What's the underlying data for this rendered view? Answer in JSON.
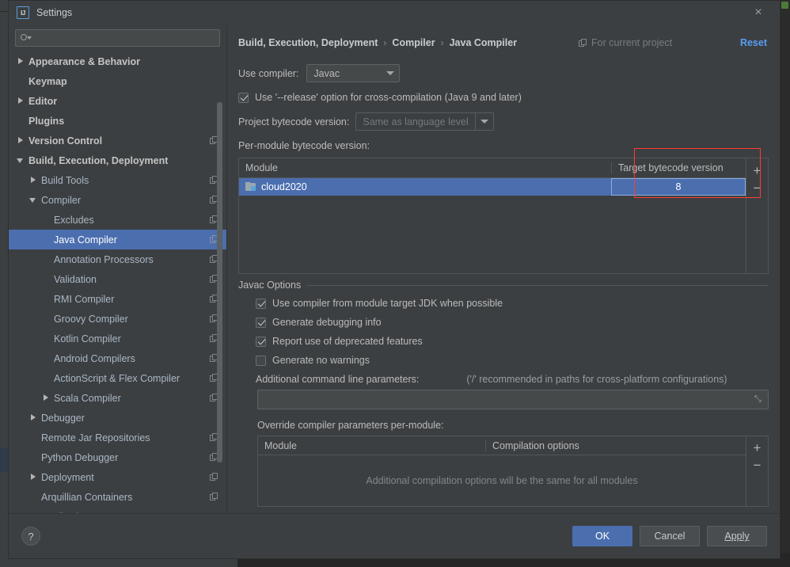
{
  "window": {
    "title": "Settings",
    "app_icon": "IJ",
    "close_icon": "×"
  },
  "sidebar": {
    "search": {
      "placeholder": "",
      "value": ""
    },
    "items": [
      {
        "label": "Appearance & Behavior",
        "indent": 0,
        "arrow": "right",
        "bold": true,
        "copy": false,
        "selected": false
      },
      {
        "label": "Keymap",
        "indent": 0,
        "arrow": "none",
        "bold": true,
        "copy": false,
        "selected": false
      },
      {
        "label": "Editor",
        "indent": 0,
        "arrow": "right",
        "bold": true,
        "copy": false,
        "selected": false
      },
      {
        "label": "Plugins",
        "indent": 0,
        "arrow": "none",
        "bold": true,
        "copy": false,
        "selected": false
      },
      {
        "label": "Version Control",
        "indent": 0,
        "arrow": "right",
        "bold": true,
        "copy": true,
        "selected": false
      },
      {
        "label": "Build, Execution, Deployment",
        "indent": 0,
        "arrow": "down",
        "bold": true,
        "copy": false,
        "selected": false
      },
      {
        "label": "Build Tools",
        "indent": 1,
        "arrow": "right",
        "bold": false,
        "copy": true,
        "selected": false
      },
      {
        "label": "Compiler",
        "indent": 1,
        "arrow": "down",
        "bold": false,
        "copy": true,
        "selected": false
      },
      {
        "label": "Excludes",
        "indent": 2,
        "arrow": "none",
        "bold": false,
        "copy": true,
        "selected": false
      },
      {
        "label": "Java Compiler",
        "indent": 2,
        "arrow": "none",
        "bold": false,
        "copy": true,
        "selected": true
      },
      {
        "label": "Annotation Processors",
        "indent": 2,
        "arrow": "none",
        "bold": false,
        "copy": true,
        "selected": false
      },
      {
        "label": "Validation",
        "indent": 2,
        "arrow": "none",
        "bold": false,
        "copy": true,
        "selected": false
      },
      {
        "label": "RMI Compiler",
        "indent": 2,
        "arrow": "none",
        "bold": false,
        "copy": true,
        "selected": false
      },
      {
        "label": "Groovy Compiler",
        "indent": 2,
        "arrow": "none",
        "bold": false,
        "copy": true,
        "selected": false
      },
      {
        "label": "Kotlin Compiler",
        "indent": 2,
        "arrow": "none",
        "bold": false,
        "copy": true,
        "selected": false
      },
      {
        "label": "Android Compilers",
        "indent": 2,
        "arrow": "none",
        "bold": false,
        "copy": true,
        "selected": false
      },
      {
        "label": "ActionScript & Flex Compiler",
        "indent": 2,
        "arrow": "none",
        "bold": false,
        "copy": true,
        "selected": false
      },
      {
        "label": "Scala Compiler",
        "indent": 2,
        "arrow": "right",
        "bold": false,
        "copy": true,
        "selected": false
      },
      {
        "label": "Debugger",
        "indent": 1,
        "arrow": "right",
        "bold": false,
        "copy": false,
        "selected": false
      },
      {
        "label": "Remote Jar Repositories",
        "indent": 1,
        "arrow": "none",
        "bold": false,
        "copy": true,
        "selected": false
      },
      {
        "label": "Python Debugger",
        "indent": 1,
        "arrow": "none",
        "bold": false,
        "copy": true,
        "selected": false
      },
      {
        "label": "Deployment",
        "indent": 1,
        "arrow": "right",
        "bold": false,
        "copy": true,
        "selected": false
      },
      {
        "label": "Arquillian Containers",
        "indent": 1,
        "arrow": "none",
        "bold": false,
        "copy": true,
        "selected": false
      },
      {
        "label": "Application Servers",
        "indent": 1,
        "arrow": "none",
        "bold": false,
        "copy": false,
        "selected": false
      }
    ]
  },
  "main": {
    "breadcrumb": [
      "Build, Execution, Deployment",
      "Compiler",
      "Java Compiler"
    ],
    "breadcrumb_separator": "›",
    "for_current_project": "For current project",
    "reset_label": "Reset",
    "use_compiler_label": "Use compiler:",
    "use_compiler_value": "Javac",
    "release_option_label": "Use '--release' option for cross-compilation (Java 9 and later)",
    "release_option_checked": true,
    "project_bytecode_label": "Project bytecode version:",
    "project_bytecode_value": "Same as language level",
    "per_module_label": "Per-module bytecode version:",
    "module_table": {
      "columns": [
        "Module",
        "Target bytecode version"
      ],
      "rows": [
        {
          "module": "cloud2020",
          "target": "8",
          "selected": true
        }
      ],
      "add_label": "+",
      "remove_label": "−"
    },
    "javac_options": {
      "title": "Javac Options",
      "checkboxes": [
        {
          "label": "Use compiler from module target JDK when possible",
          "checked": true
        },
        {
          "label": "Generate debugging info",
          "checked": true
        },
        {
          "label": "Report use of deprecated features",
          "checked": true
        },
        {
          "label": "Generate no warnings",
          "checked": false
        }
      ],
      "params_label": "Additional command line parameters:",
      "params_hint": "('/' recommended in paths for cross-platform configurations)",
      "params_value": "",
      "expand_icon": "⤡",
      "override_label": "Override compiler parameters per-module:",
      "override_table": {
        "columns": [
          "Module",
          "Compilation options"
        ],
        "empty_text": "Additional compilation options will be the same for all modules",
        "add_label": "+",
        "remove_label": "−"
      }
    }
  },
  "footer": {
    "help_label": "?",
    "ok_label": "OK",
    "cancel_label": "Cancel",
    "apply_label": "Apply"
  },
  "colors": {
    "accent": "#4b6eaf",
    "link": "#589df6",
    "highlight_box": "#ff3b30",
    "panel_bg": "#3c3f41",
    "field_bg": "#45494a"
  }
}
